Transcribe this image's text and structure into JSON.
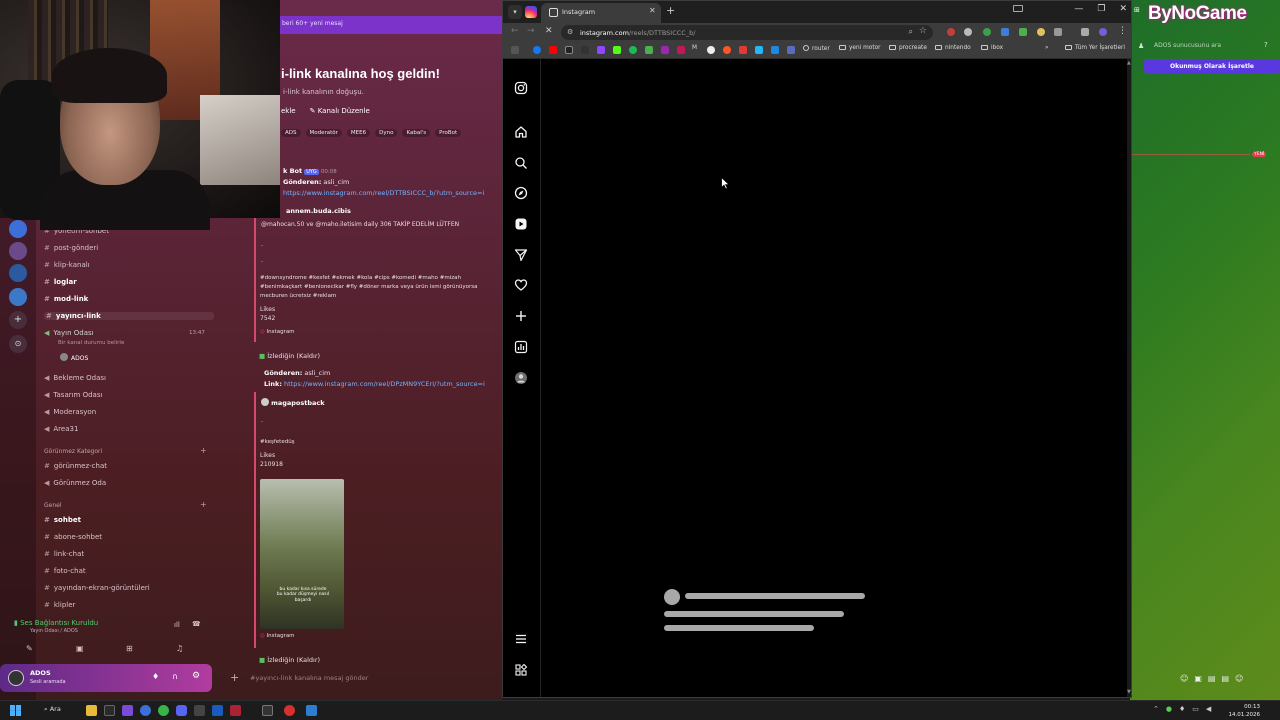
{
  "browser": {
    "tab_title": "Instagram",
    "url_host": "instagram.com",
    "url_path": "/reels/DTTBSICCC_b/",
    "bookmarks": [
      "router",
      "yeni motor",
      "procreate",
      "nintendo",
      "ibox",
      "Tüm Yer İşaretleri"
    ],
    "bookmark_m": "M"
  },
  "instagram": {
    "rail_icons": [
      "instagram-logo-icon",
      "home-icon",
      "search-icon",
      "explore-icon",
      "reels-icon",
      "messages-icon",
      "notifications-icon",
      "create-icon",
      "dashboard-icon",
      "profile-icon",
      "menu-icon",
      "also-from-meta-icon"
    ]
  },
  "discord_left": {
    "banner": "beri 60+ yeni mesaj",
    "channel_heading": "i-link kanalına hoş geldin!",
    "channel_sub": "i-link kanalının doğuşu.",
    "actions": [
      "ekle",
      "Kanalı Düzenle"
    ],
    "tags": [
      "ADS",
      "Moderatör",
      "MEE6",
      "Dyno",
      "Kabal's",
      "ProBot"
    ],
    "msg1_author": "k Bot",
    "msg1_badge": "UYG",
    "msg1_time": "00:08",
    "msg1_sender_label": "Gönderen:",
    "msg1_sender": "asli_cim",
    "msg1_link": "https://www.instagram.com/reel/DTTBSICCC_b/?utm_source=i",
    "msg1_profile": "annem.buda.cibis",
    "msg1_caption": "@mahocan.50 ve @maho.iletisim daily 306 TAKİP EDELİM LÜTFEN",
    "msg1_dots": ".",
    "msg1_hashtags1": "#downsyndrome #kesfet #ekmek #kola #cips #komedi #maho #mizah",
    "msg1_hashtags2": "#benimkaçkart #benionecikar #fly #döner marka veya ürün ismi görünüyorsa",
    "msg1_hashtags3": "mecburen ücretsiz #reklam",
    "likes_label": "Likes",
    "msg1_likes": "7542",
    "instagram_label": "Instagram",
    "ignored_label": "İzlediğin (Kaldır)",
    "msg2_sender_label": "Gönderen:",
    "msg2_sender": "asli_cim",
    "msg2_link_label": "Link:",
    "msg2_link": "https://www.instagram.com/reel/DPzMN9YCErI/?utm_source=i",
    "msg2_profile": "magapostback",
    "msg2_hashtag": "#keşfetedüş",
    "msg2_likes": "210918",
    "thumb_caption": "bu kadar kısa sürede bu kadar düşmeyi nasıl başardı",
    "input_placeholder": "#yayıncı-link kanalına mesaj gönder"
  },
  "discord_sidebar": {
    "channels": [
      {
        "name": "yönetim-sohbet",
        "bold": false
      },
      {
        "name": "post-gönderi",
        "bold": false
      },
      {
        "name": "klip-kanalı",
        "bold": false
      },
      {
        "name": "loglar",
        "bold": true
      },
      {
        "name": "mod-link",
        "bold": true
      },
      {
        "name": "yayıncı-link",
        "bold": true
      }
    ],
    "voice_channel": "Yayın Odası",
    "voice_time": "13:47",
    "voice_sub": "Bir kanal durumu belirle",
    "voice_user": "ADOS",
    "voice_rooms": [
      "Bekleme Odası",
      "Tasarım Odası",
      "Moderasyon",
      "Area31"
    ],
    "cat_hidden": "Görünmez Kategori",
    "hidden_channels": [
      "görünmez-chat",
      "Görünmez Oda"
    ],
    "cat_general": "Genel",
    "general_channels": [
      {
        "name": "sohbet",
        "bold": true
      },
      {
        "name": "abone-sohbet",
        "bold": false
      },
      {
        "name": "link-chat",
        "bold": false
      },
      {
        "name": "foto-chat",
        "bold": false
      },
      {
        "name": "yayından-ekran-görüntüleri",
        "bold": false
      },
      {
        "name": "klipler",
        "bold": false
      }
    ],
    "voice_status": "Ses Bağlantısı Kuruldu",
    "voice_status_sub": "Yayın Odası / ADOS",
    "user_name": "ADOS",
    "user_status": "Sesli aramada"
  },
  "discord_right": {
    "logo": "ByNoGame",
    "search": "ADOS sunucusunu ara",
    "mark_read": "Okunmuş Olarak İşaretle",
    "new_badge": "YENİ"
  },
  "taskbar": {
    "search_label": "Ara",
    "time": "00:13",
    "date": "14.01.2026"
  }
}
